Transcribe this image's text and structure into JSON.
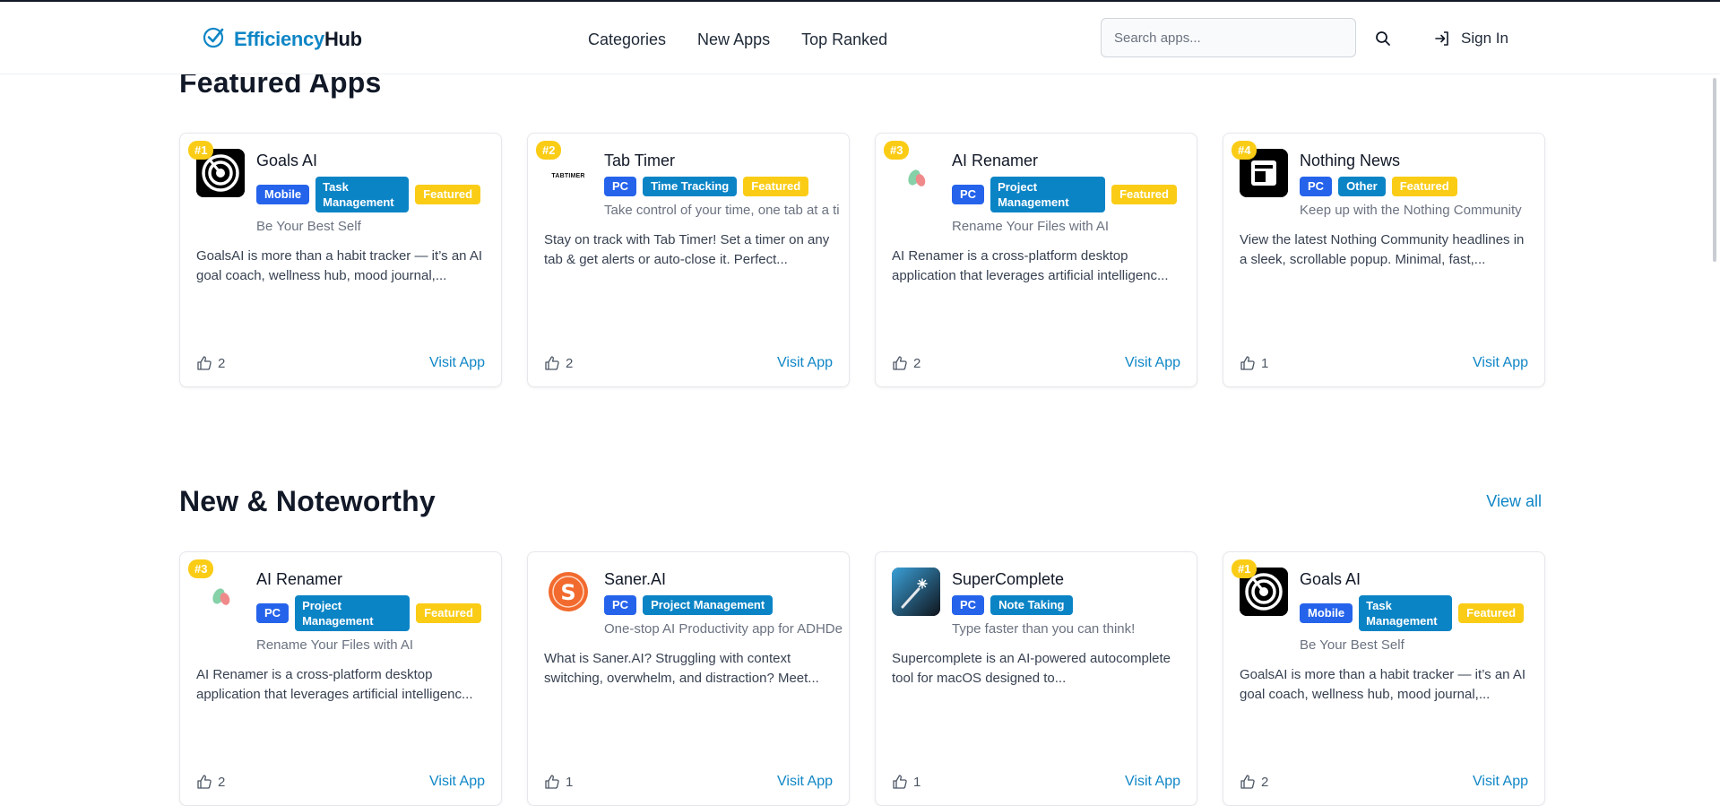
{
  "header": {
    "logo_part1": "Efficiency",
    "logo_part2": "Hub",
    "nav": [
      "Categories",
      "New Apps",
      "Top Ranked"
    ],
    "search_placeholder": "Search apps...",
    "signin_label": "Sign In"
  },
  "featured": {
    "title": "Featured Apps",
    "cards": [
      {
        "rank": "#1",
        "name": "Goals AI",
        "icon": "goals-ai-logo",
        "tags": [
          "Mobile",
          "Task Management",
          "Featured"
        ],
        "tagline": "Be Your Best Self",
        "description": "GoalsAI is more than a habit tracker — it’s an AI goal coach, wellness hub, mood journal,...",
        "likes": "2",
        "visit": "Visit App"
      },
      {
        "rank": "#2",
        "name": "Tab Timer",
        "icon": "tab-timer-logo",
        "icon_text": "TABTIMER",
        "tags": [
          "PC",
          "Time Tracking",
          "Featured"
        ],
        "tagline": "Take control of your time, one tab at a ti",
        "description": "Stay on track with Tab Timer! Set a timer on any tab & get alerts or auto-close it. Perfect...",
        "likes": "2",
        "visit": "Visit App"
      },
      {
        "rank": "#3",
        "name": "AI Renamer",
        "icon": "ai-renamer-logo",
        "tags": [
          "PC",
          "Project Management",
          "Featured"
        ],
        "tagline": "Rename Your Files with AI",
        "description": "AI Renamer is a cross-platform desktop application that leverages artificial intelligenc...",
        "likes": "2",
        "visit": "Visit App"
      },
      {
        "rank": "#4",
        "name": "Nothing News",
        "icon": "nothing-news-logo",
        "tags": [
          "PC",
          "Other",
          "Featured"
        ],
        "tagline": "Keep up with the Nothing Community",
        "description": "View the latest Nothing Community headlines in a sleek, scrollable popup. Minimal, fast,...",
        "likes": "1",
        "visit": "Visit App"
      }
    ]
  },
  "noteworthy": {
    "title": "New & Noteworthy",
    "view_all": "View all",
    "cards": [
      {
        "rank": "#3",
        "name": "AI Renamer",
        "icon": "ai-renamer-logo",
        "tags": [
          "PC",
          "Project Management",
          "Featured"
        ],
        "tagline": "Rename Your Files with AI",
        "description": "AI Renamer is a cross-platform desktop application that leverages artificial intelligenc...",
        "likes": "2",
        "visit": "Visit App"
      },
      {
        "rank": "",
        "name": "Saner.AI",
        "icon": "saner-ai-logo",
        "tags": [
          "PC",
          "Project Management"
        ],
        "tagline": "One-stop AI Productivity app for ADHDe",
        "description": "What is Saner.AI? Struggling with context switching, overwhelm, and distraction? Meet...",
        "likes": "1",
        "visit": "Visit App"
      },
      {
        "rank": "",
        "name": "SuperComplete",
        "icon": "supercomplete-logo",
        "tags": [
          "PC",
          "Note Taking"
        ],
        "tagline": "Type faster than you can think!",
        "description": "Supercomplete is an AI-powered autocomplete tool for macOS designed to...",
        "likes": "1",
        "visit": "Visit App"
      },
      {
        "rank": "#1",
        "name": "Goals AI",
        "icon": "goals-ai-logo",
        "tags": [
          "Mobile",
          "Task Management",
          "Featured"
        ],
        "tagline": "Be Your Best Self",
        "description": "GoalsAI is more than a habit tracker — it’s an AI goal coach, wellness hub, mood journal,...",
        "likes": "2",
        "visit": "Visit App"
      }
    ]
  },
  "colors": {
    "brand": "#0f86c6",
    "platform_tag": "#2563eb",
    "category_tag": "#0b84c6",
    "featured_tag": "#facc15"
  }
}
